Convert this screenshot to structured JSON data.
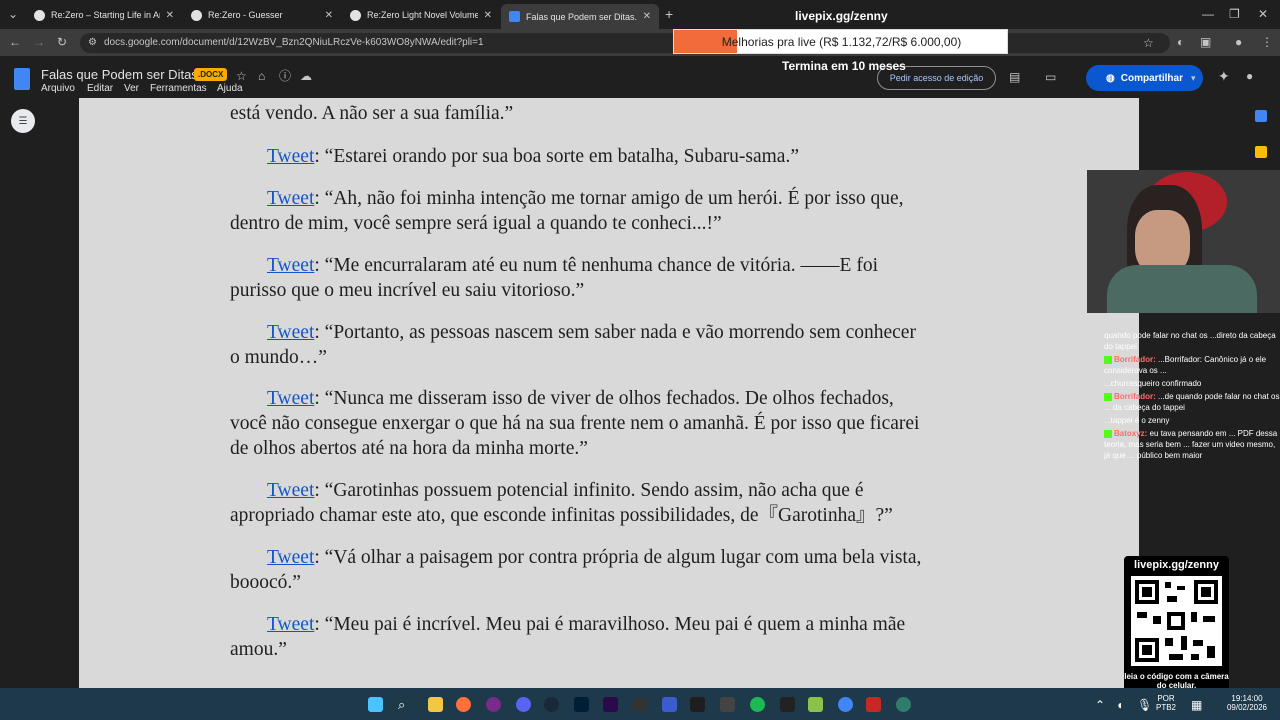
{
  "browser": {
    "tabs": [
      {
        "title": "Re:Zero – Starting Life in Anoth",
        "active": false
      },
      {
        "title": "Re:Zero - Guesser",
        "active": false
      },
      {
        "title": "Re:Zero Light Novel Volume 39",
        "active": false
      },
      {
        "title": "Falas que Podem ser Ditas.docx",
        "active": true
      }
    ],
    "url": "docs.google.com/document/d/12WzBV_Bzn2QNiuLRczVe-k603WO8yNWA/edit?pli=1"
  },
  "docs": {
    "title": "Falas que Podem ser Ditas",
    "badge": ".DOCX",
    "menu": [
      "Arquivo",
      "Editar",
      "Ver",
      "Ferramentas",
      "Ajuda"
    ],
    "request_edit": "Pedir acesso de edição",
    "share": "Compartilhar"
  },
  "document": {
    "top_fragment": "está vendo. A não ser a sua família.”",
    "paragraphs": [
      {
        "speaker": "Tweet",
        "lines": [
          ": “Estarei orando por sua boa sorte em batalha, Subaru-sama.”"
        ]
      },
      {
        "speaker": "Tweet",
        "lines": [
          ": “Ah, não foi minha intenção me tornar amigo de um herói. É por isso que,",
          "dentro de mim, você sempre será igual a quando te conheci...!”"
        ]
      },
      {
        "speaker": "Tweet",
        "lines": [
          ": “Me encurralaram até eu num tê nenhuma chance de vitória. ——E foi",
          "purisso que o meu incrível eu saiu vitorioso.”"
        ]
      },
      {
        "speaker": "Tweet",
        "lines": [
          ": “Portanto, as pessoas nascem sem saber nada e vão morrendo sem conhecer",
          "o mundo…”"
        ]
      },
      {
        "speaker": "Tweet",
        "lines": [
          ": “Nunca me disseram isso de viver de olhos fechados. De olhos fechados,",
          "você não consegue enxergar o que há na sua frente nem o amanhã. É por isso que ficarei",
          "de olhos abertos até na hora da minha morte.”"
        ]
      },
      {
        "speaker": "Tweet",
        "lines": [
          ": “Garotinhas possuem potencial infinito. Sendo assim, não acha que é",
          "apropriado chamar este ato, que esconde infinitas possibilidades, de『Garotinha』?”"
        ]
      },
      {
        "speaker": "Tweet",
        "lines": [
          ": “Vá olhar a paisagem por contra própria de algum lugar com uma bela vista,",
          "booocó.”"
        ]
      },
      {
        "speaker": "Tweet",
        "lines": [
          ": “Meu pai é incrível. Meu pai é maravilhoso. Meu pai é quem a minha mãe",
          "amou.”"
        ]
      }
    ]
  },
  "overlay": {
    "livepix_top": "livepix.gg/zenny",
    "goal_text": "Melhorias pra live (R$ 1.132,72/R$ 6.000,00)",
    "goal_fraction": 0.189,
    "goal_deadline": "Termina em 10 meses",
    "qr_title": "livepix.gg/zenny",
    "qr_caption": "leia o código com a câmera do celular."
  },
  "chat": [
    {
      "user": "",
      "text": "quando pode falar no chat os ...direto da cabeça do tappei"
    },
    {
      "user": "Borrifador:",
      "text": "...Borrifador: Canônico já o ele considerava os ..."
    },
    {
      "user": "",
      "text": "...churrasqueiro confirmado"
    },
    {
      "user": "Borrifador:",
      "text": "...de quando pode falar no chat os ... da cabeça do tappei"
    },
    {
      "user": "",
      "text": "...tappei é o zenny"
    },
    {
      "user": "Batoxyz:",
      "text": "eu tava pensando em ... PDF dessa teoria, mas seria bem ... fazer um video mesmo, já que ... público bem maior"
    }
  ],
  "taskbar": {
    "lang1": "POR",
    "lang2": "PTB2",
    "time": "19:14:00",
    "date": "09/02/2026"
  }
}
